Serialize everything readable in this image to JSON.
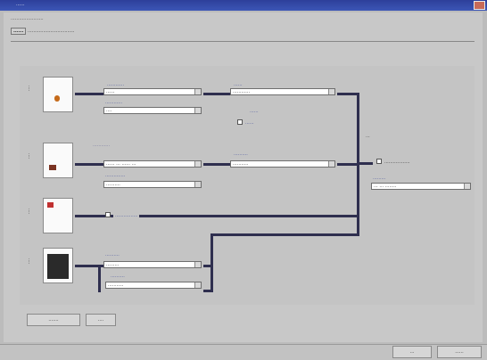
{
  "window": {
    "title": "......"
  },
  "instruction": ".......................",
  "tab": {
    "label": "......",
    "rest": "................................."
  },
  "rows": [
    {
      "label": "....",
      "top_label": "............",
      "combo1": "......",
      "sub_label": "............",
      "combo2": "....",
      "right_label": "......",
      "combo3": "............",
      "note1": "......",
      "note2": "......"
    },
    {
      "label": "....",
      "top_label": "............",
      "combo1": "...... ... ...... ...",
      "sub_label": "..............",
      "combo2": "..........",
      "right_label": "..........",
      "combo3": "..........."
    },
    {
      "label": "....",
      "mid_label": "................"
    },
    {
      "label": "....",
      "top_label": "..........",
      "combo1": ".........",
      "sub_label": "..........",
      "combo2": "..........."
    }
  ],
  "merge": {
    "label": "...",
    "check_label": "..................",
    "out_label": ".........",
    "out_combo": "... ... ........"
  },
  "buttons": {
    "left1": ".......",
    "left2": "....",
    "ok": "...",
    "cancel": "......"
  }
}
